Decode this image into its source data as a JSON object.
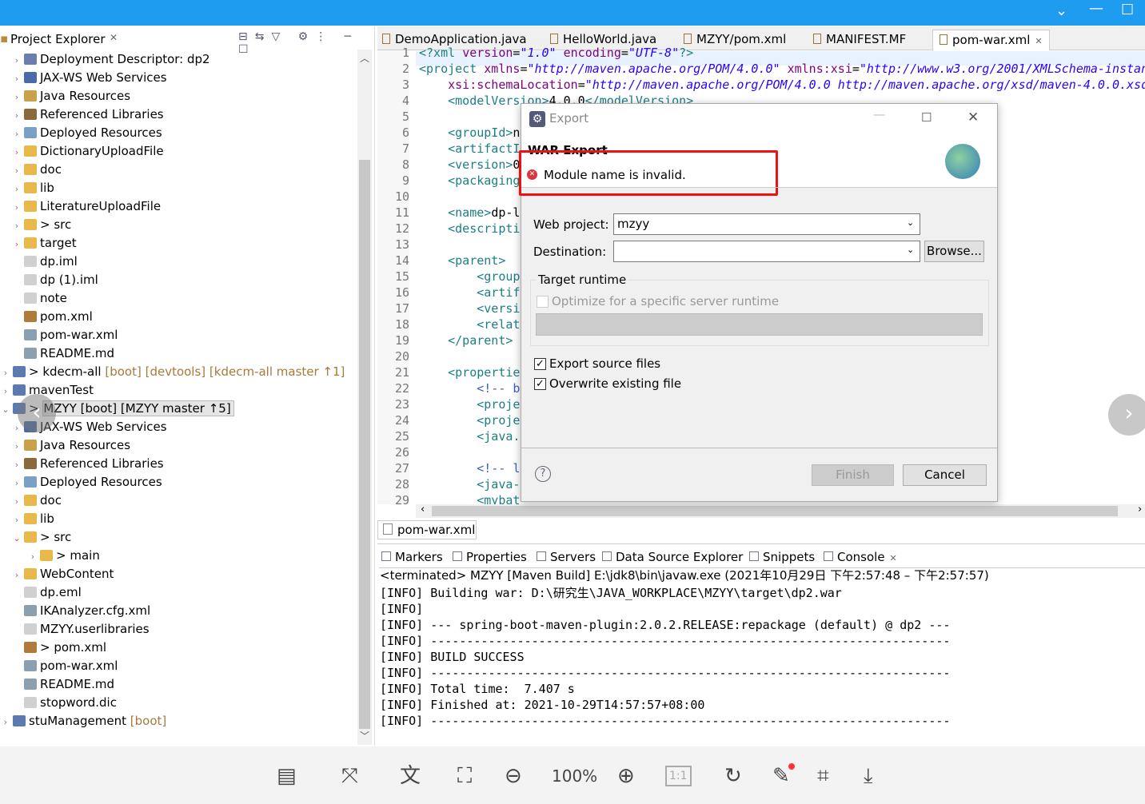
{
  "window": {
    "accent": "#1e9cf0"
  },
  "explorer": {
    "title": "Project Explorer",
    "items": [
      {
        "label": "Deployment Descriptor: dp2",
        "level": 1,
        "chev": "right",
        "color": "#6a7fb0"
      },
      {
        "label": "JAX-WS Web Services",
        "level": 1,
        "chev": "right",
        "color": "#4a6aa8"
      },
      {
        "label": "Java Resources",
        "level": 1,
        "chev": "right",
        "color": "#c9a14a"
      },
      {
        "label": "Referenced Libraries",
        "level": 1,
        "chev": "right",
        "color": "#8a6a3a"
      },
      {
        "label": "Deployed Resources",
        "level": 1,
        "chev": "right",
        "color": "#7aa0c8"
      },
      {
        "label": "DictionaryUploadFile",
        "level": 1,
        "chev": "right",
        "color": "#e8b84a"
      },
      {
        "label": "doc",
        "level": 1,
        "chev": "right",
        "color": "#e8b84a"
      },
      {
        "label": "lib",
        "level": 1,
        "chev": "right",
        "color": "#e8b84a"
      },
      {
        "label": "LiteratureUploadFile",
        "level": 1,
        "chev": "right",
        "color": "#e8b84a"
      },
      {
        "label": "src",
        "prefix": "> ",
        "level": 1,
        "chev": "right",
        "color": "#e8b84a"
      },
      {
        "label": "target",
        "level": 1,
        "chev": "right",
        "color": "#e8b84a"
      },
      {
        "label": "dp.iml",
        "level": 1,
        "chev": "none",
        "color": "#d0d0d0"
      },
      {
        "label": "dp (1).iml",
        "level": 1,
        "chev": "none",
        "color": "#d0d0d0"
      },
      {
        "label": "note",
        "level": 1,
        "chev": "none",
        "color": "#d0d0d0"
      },
      {
        "label": "pom.xml",
        "level": 1,
        "chev": "none",
        "color": "#b07a3a"
      },
      {
        "label": "pom-war.xml",
        "level": 1,
        "chev": "none",
        "color": "#8aa0b0"
      },
      {
        "label": "README.md",
        "level": 1,
        "chev": "none",
        "color": "#8aa0b0"
      },
      {
        "label": "kdecm-all",
        "prefix": "> ",
        "deco": " [boot] [devtools] [kdecm-all master ↑1]",
        "level": 0,
        "chev": "right",
        "color": "#5a7ab0"
      },
      {
        "label": "mavenTest",
        "level": 0,
        "chev": "right",
        "color": "#5a7ab0"
      },
      {
        "label": "MZYY [boot] [MZYY master ↑5]",
        "prefix": "> ",
        "level": 0,
        "chev": "down",
        "color": "#5a7ab0",
        "selected": true
      },
      {
        "label": "JAX-WS Web Services",
        "level": 1,
        "chev": "right",
        "color": "#4a6aa8"
      },
      {
        "label": "Java Resources",
        "level": 1,
        "chev": "right",
        "color": "#c9a14a"
      },
      {
        "label": "Referenced Libraries",
        "level": 1,
        "chev": "right",
        "color": "#8a6a3a"
      },
      {
        "label": "Deployed Resources",
        "level": 1,
        "chev": "right",
        "color": "#7aa0c8"
      },
      {
        "label": "doc",
        "level": 1,
        "chev": "right",
        "color": "#e8b84a"
      },
      {
        "label": "lib",
        "level": 1,
        "chev": "right",
        "color": "#e8b84a"
      },
      {
        "label": "src",
        "prefix": "> ",
        "level": 1,
        "chev": "down",
        "color": "#e8b84a"
      },
      {
        "label": "main",
        "prefix": "> ",
        "level": 2,
        "chev": "right",
        "color": "#e8b84a"
      },
      {
        "label": "WebContent",
        "level": 1,
        "chev": "right",
        "color": "#e8b84a"
      },
      {
        "label": "dp.eml",
        "level": 1,
        "chev": "none",
        "color": "#d0d0d0"
      },
      {
        "label": "IKAnalyzer.cfg.xml",
        "level": 1,
        "chev": "none",
        "color": "#8aa0b0"
      },
      {
        "label": "MZYY.userlibraries",
        "level": 1,
        "chev": "none",
        "color": "#d0d0d0"
      },
      {
        "label": "pom.xml",
        "prefix": "> ",
        "level": 1,
        "chev": "none",
        "color": "#b07a3a"
      },
      {
        "label": "pom-war.xml",
        "level": 1,
        "chev": "none",
        "color": "#8aa0b0"
      },
      {
        "label": "README.md",
        "level": 1,
        "chev": "none",
        "color": "#8aa0b0"
      },
      {
        "label": "stopword.dic",
        "level": 1,
        "chev": "none",
        "color": "#d0d0d0"
      },
      {
        "label": "stuManagement",
        "deco": " [boot]",
        "level": 0,
        "chev": "right",
        "color": "#5a7ab0"
      }
    ]
  },
  "editor": {
    "tabs": [
      {
        "label": "DemoApplication.java"
      },
      {
        "label": "HelloWorld.java"
      },
      {
        "label": "MZYY/pom.xml"
      },
      {
        "label": "MANIFEST.MF"
      },
      {
        "label": "pom-war.xml",
        "active": true
      }
    ],
    "bottom_tab": "pom-war.xml",
    "lines": [
      [
        [
          "t",
          "<?xml "
        ],
        [
          "a",
          "version"
        ],
        [
          "k",
          "="
        ],
        [
          "v",
          "\"1.0\""
        ],
        [
          "a",
          " encoding"
        ],
        [
          "k",
          "="
        ],
        [
          "v",
          "\"UTF-8\""
        ],
        [
          "t",
          "?>"
        ]
      ],
      [
        [
          "t",
          "<project "
        ],
        [
          "a",
          "xmlns"
        ],
        [
          "k",
          "="
        ],
        [
          "v",
          "\"http://maven.apache.org/POM/4.0.0\""
        ],
        [
          "a",
          " xmlns:xsi"
        ],
        [
          "k",
          "="
        ],
        [
          "v",
          "\"http://www.w3.org/2001/XMLSchema-instan"
        ]
      ],
      [
        [
          "a",
          "    xsi:schemaLocation"
        ],
        [
          "k",
          "="
        ],
        [
          "v",
          "\"http://maven.apache.org/POM/4.0.0 http://maven.apache.org/xsd/maven-4.0.0.xsd"
        ]
      ],
      [
        [
          "t",
          "    <modelVersion>"
        ],
        [
          "k",
          "4.0.0"
        ],
        [
          "t",
          "</modelVersion>"
        ]
      ],
      [],
      [
        [
          "t",
          "    <groupId>"
        ],
        [
          "k",
          "n"
        ]
      ],
      [
        [
          "t",
          "    <artifactI"
        ]
      ],
      [
        [
          "t",
          "    <version>"
        ],
        [
          "k",
          "0"
        ]
      ],
      [
        [
          "t",
          "    <packaging"
        ]
      ],
      [],
      [
        [
          "t",
          "    <name>"
        ],
        [
          "k",
          "dp-l"
        ]
      ],
      [
        [
          "t",
          "    <descripti"
        ]
      ],
      [],
      [
        [
          "t",
          "    <parent>"
        ]
      ],
      [
        [
          "t",
          "        <group"
        ]
      ],
      [
        [
          "t",
          "        <artif"
        ]
      ],
      [
        [
          "t",
          "        <versi"
        ]
      ],
      [
        [
          "t",
          "        <relat"
        ]
      ],
      [
        [
          "t",
          "    </parent>"
        ]
      ],
      [],
      [
        [
          "t",
          "    <propertie"
        ]
      ],
      [
        [
          "c",
          "        <!-- b"
        ]
      ],
      [
        [
          "t",
          "        <proje"
        ]
      ],
      [
        [
          "t",
          "        <proje                                                   g>"
        ]
      ],
      [
        [
          "t",
          "        <java."
        ]
      ],
      [],
      [
        [
          "c",
          "        <!-- l"
        ]
      ],
      [
        [
          "t",
          "        <java-"
        ]
      ],
      [
        [
          "t",
          "        <mybat"
        ]
      ]
    ]
  },
  "dialog": {
    "title": "Export",
    "heading": "WAR Export",
    "error": "Module name is invalid.",
    "web_project_label": "Web project:",
    "web_project_value": "mzyy",
    "destination_label": "Destination:",
    "destination_value": "",
    "browse": "Browse...",
    "runtime_group": "Target runtime",
    "optimize": "Optimize for a specific server runtime",
    "export_source": "Export source files",
    "overwrite": "Overwrite existing file",
    "finish": "Finish",
    "cancel": "Cancel"
  },
  "panel": {
    "tabs": [
      {
        "label": "Markers"
      },
      {
        "label": "Properties"
      },
      {
        "label": "Servers"
      },
      {
        "label": "Data Source Explorer"
      },
      {
        "label": "Snippets"
      },
      {
        "label": "Console",
        "active": true
      }
    ],
    "status": "<terminated> MZYY [Maven Build] E:\\jdk8\\bin\\javaw.exe  (2021年10月29日 下午2:57:48 – 下午2:57:57)",
    "lines": [
      "[INFO] Building war: D:\\研究生\\JAVA_WORKPLACE\\MZYY\\target\\dp2.war",
      "[INFO]",
      "[INFO] --- spring-boot-maven-plugin:2.0.2.RELEASE:repackage (default) @ dp2 ---",
      "[INFO] ------------------------------------------------------------------------",
      "[INFO] BUILD SUCCESS",
      "[INFO] ------------------------------------------------------------------------",
      "[INFO] Total time:  7.407 s",
      "[INFO] Finished at: 2021-10-29T14:57:57+08:00",
      "[INFO] ------------------------------------------------------------------------"
    ]
  },
  "viewer": {
    "zoom": "100%"
  }
}
